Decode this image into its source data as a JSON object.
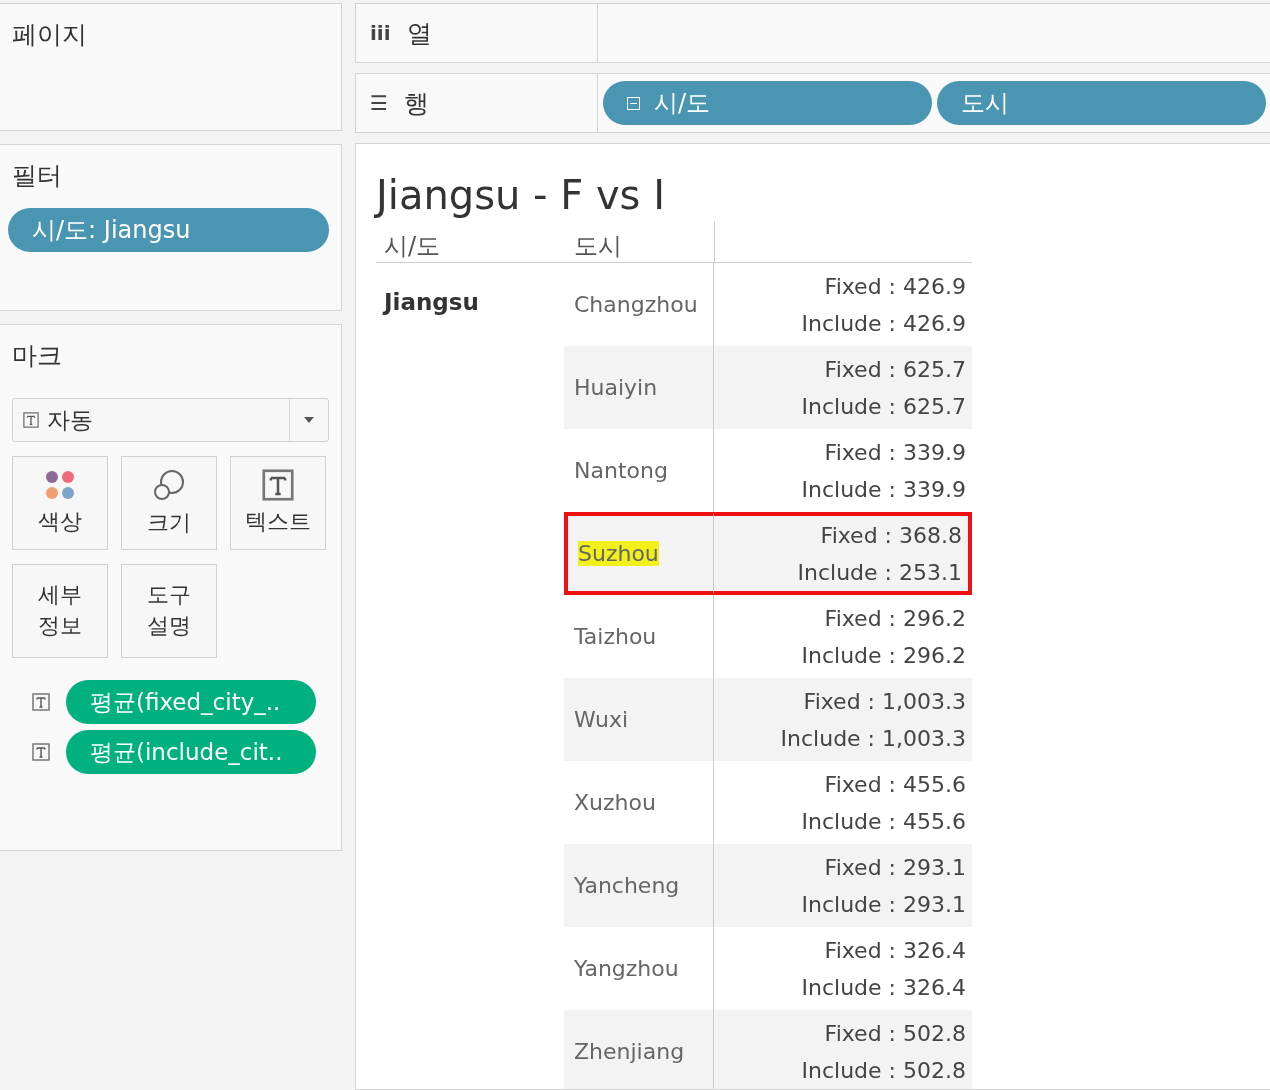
{
  "pages_panel": {
    "title": "페이지"
  },
  "columns_shelf": {
    "icon": "iii",
    "label": "열"
  },
  "rows_shelf": {
    "icon": "☰",
    "label": "행",
    "pills": [
      {
        "label": "시/도",
        "collapsible": true
      },
      {
        "label": "도시",
        "collapsible": false
      }
    ]
  },
  "filters_panel": {
    "title": "필터",
    "pills": [
      {
        "label": "시/도: Jiangsu"
      }
    ]
  },
  "marks_panel": {
    "title": "마크",
    "mark_type": "자동",
    "cards": [
      {
        "kind": "color",
        "label": "색상"
      },
      {
        "kind": "size",
        "label": "크기"
      },
      {
        "kind": "text",
        "label": "텍스트"
      },
      {
        "kind": "plain",
        "label": "세부\n정보"
      },
      {
        "kind": "plain",
        "label": "도구\n설명"
      }
    ],
    "fields": [
      {
        "label": "평균(fixed_city_.."
      },
      {
        "label": "평균(include_cit.."
      }
    ]
  },
  "view": {
    "title": "Jiangsu - F vs I",
    "headers": [
      "시/도",
      "도시"
    ],
    "province": "Jiangsu",
    "rows": [
      {
        "city": "Changzhou",
        "fixed": "Fixed : 426.9",
        "include": "Include : 426.9",
        "highlighted": false
      },
      {
        "city": "Huaiyin",
        "fixed": "Fixed : 625.7",
        "include": "Include : 625.7",
        "highlighted": false
      },
      {
        "city": "Nantong",
        "fixed": "Fixed : 339.9",
        "include": "Include : 339.9",
        "highlighted": false
      },
      {
        "city": "Suzhou",
        "fixed": "Fixed : 368.8",
        "include": "Include : 253.1",
        "highlighted": true
      },
      {
        "city": "Taizhou",
        "fixed": "Fixed : 296.2",
        "include": "Include : 296.2",
        "highlighted": false
      },
      {
        "city": "Wuxi",
        "fixed": "Fixed : 1,003.3",
        "include": "Include : 1,003.3",
        "highlighted": false
      },
      {
        "city": "Xuzhou",
        "fixed": "Fixed : 455.6",
        "include": "Include : 455.6",
        "highlighted": false
      },
      {
        "city": "Yancheng",
        "fixed": "Fixed : 293.1",
        "include": "Include : 293.1",
        "highlighted": false
      },
      {
        "city": "Yangzhou",
        "fixed": "Fixed : 326.4",
        "include": "Include : 326.4",
        "highlighted": false
      },
      {
        "city": "Zhenjiang",
        "fixed": "Fixed : 502.8",
        "include": "Include : 502.8",
        "highlighted": false
      }
    ]
  }
}
